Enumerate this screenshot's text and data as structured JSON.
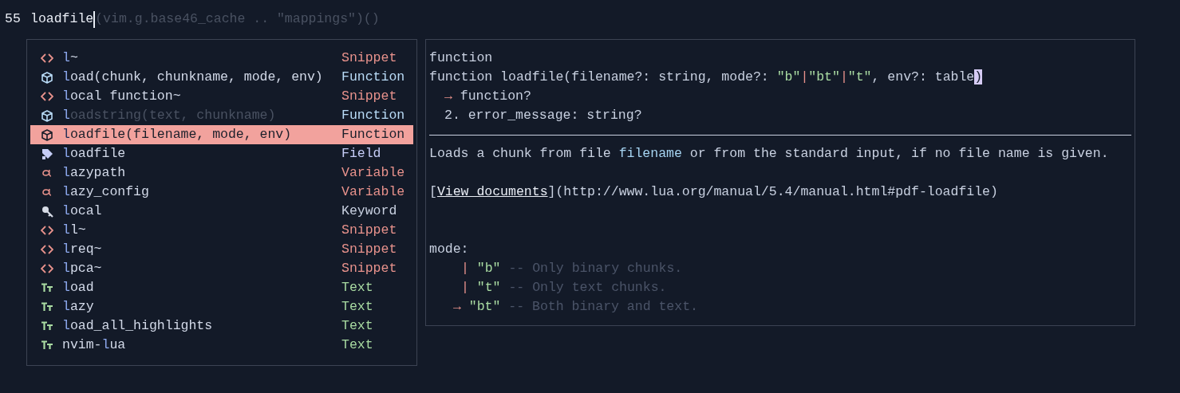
{
  "editor": {
    "lines": [
      {
        "number": "55",
        "typed": "loadfile",
        "ghost": "(vim.g.base46_cache .. \"mappings\")()",
        "cursor": true
      }
    ]
  },
  "completion": {
    "items": [
      {
        "kind": "snippet",
        "label": [
          {
            "text": "l",
            "matched": true
          },
          {
            "text": "~",
            "matched": false
          }
        ],
        "type_label": "Snippet",
        "selected": false,
        "dimmed": false
      },
      {
        "kind": "function",
        "label": [
          {
            "text": "l",
            "matched": true
          },
          {
            "text": "oad(chunk, chunkname, mode, env)",
            "matched": false
          }
        ],
        "type_label": "Function",
        "selected": false,
        "dimmed": false
      },
      {
        "kind": "snippet",
        "label": [
          {
            "text": "l",
            "matched": true
          },
          {
            "text": "ocal function~",
            "matched": false
          }
        ],
        "type_label": "Snippet",
        "selected": false,
        "dimmed": false
      },
      {
        "kind": "function",
        "label": [
          {
            "text": "l",
            "matched": true
          },
          {
            "text": "oadstring(text, chunkname)",
            "matched": false
          }
        ],
        "type_label": "Function",
        "selected": false,
        "dimmed": true
      },
      {
        "kind": "function",
        "label": [
          {
            "text": "l",
            "matched": true
          },
          {
            "text": "oadfile(filename, mode, env)",
            "matched": false
          }
        ],
        "type_label": "Function",
        "selected": true,
        "dimmed": false
      },
      {
        "kind": "field",
        "label": [
          {
            "text": "l",
            "matched": true
          },
          {
            "text": "oadfile",
            "matched": false
          }
        ],
        "type_label": "Field",
        "selected": false,
        "dimmed": false
      },
      {
        "kind": "variable",
        "label": [
          {
            "text": "l",
            "matched": true
          },
          {
            "text": "azypath",
            "matched": false
          }
        ],
        "type_label": "Variable",
        "selected": false,
        "dimmed": false
      },
      {
        "kind": "variable",
        "label": [
          {
            "text": "l",
            "matched": true
          },
          {
            "text": "azy_config",
            "matched": false
          }
        ],
        "type_label": "Variable",
        "selected": false,
        "dimmed": false
      },
      {
        "kind": "keyword",
        "label": [
          {
            "text": "l",
            "matched": true
          },
          {
            "text": "ocal",
            "matched": false
          }
        ],
        "type_label": "Keyword",
        "selected": false,
        "dimmed": false
      },
      {
        "kind": "snippet",
        "label": [
          {
            "text": "l",
            "matched": true
          },
          {
            "text": "l~",
            "matched": false
          }
        ],
        "type_label": "Snippet",
        "selected": false,
        "dimmed": false
      },
      {
        "kind": "snippet",
        "label": [
          {
            "text": "l",
            "matched": true
          },
          {
            "text": "req~",
            "matched": false
          }
        ],
        "type_label": "Snippet",
        "selected": false,
        "dimmed": false
      },
      {
        "kind": "snippet",
        "label": [
          {
            "text": "l",
            "matched": true
          },
          {
            "text": "pca~",
            "matched": false
          }
        ],
        "type_label": "Snippet",
        "selected": false,
        "dimmed": false
      },
      {
        "kind": "text",
        "label": [
          {
            "text": "l",
            "matched": true
          },
          {
            "text": "oad",
            "matched": false
          }
        ],
        "type_label": "Text",
        "selected": false,
        "dimmed": false
      },
      {
        "kind": "text",
        "label": [
          {
            "text": "l",
            "matched": true
          },
          {
            "text": "azy",
            "matched": false
          }
        ],
        "type_label": "Text",
        "selected": false,
        "dimmed": false
      },
      {
        "kind": "text",
        "label": [
          {
            "text": "l",
            "matched": true
          },
          {
            "text": "oad_all_highlights",
            "matched": false
          }
        ],
        "type_label": "Text",
        "selected": false,
        "dimmed": false
      },
      {
        "kind": "text",
        "label": [
          {
            "text": "nvim-",
            "matched": false
          },
          {
            "text": "l",
            "matched": true
          },
          {
            "text": "ua",
            "matched": false
          }
        ],
        "type_label": "Text",
        "selected": false,
        "dimmed": false
      }
    ]
  },
  "documentation": {
    "header": "function",
    "signature": [
      {
        "kind": "plain",
        "text": "function loadfile(filename?: string, mode?: ",
        "cursor": false
      },
      {
        "kind": "string",
        "text": "\"b\"",
        "cursor": false
      },
      {
        "kind": "pipe",
        "text": "|",
        "cursor": false
      },
      {
        "kind": "string",
        "text": "\"bt\"",
        "cursor": false
      },
      {
        "kind": "pipe",
        "text": "|",
        "cursor": false
      },
      {
        "kind": "string",
        "text": "\"t\"",
        "cursor": false
      },
      {
        "kind": "plain",
        "text": ", env?: table",
        "cursor": false
      },
      {
        "kind": "plain",
        "text": ")",
        "cursor": true
      }
    ],
    "returns": [
      {
        "marker": "→",
        "text": "function?",
        "kind": "arrow"
      },
      {
        "marker": "2.",
        "text": "error_message: string?",
        "kind": "number"
      }
    ],
    "description": [
      {
        "kind": "plain",
        "text": "Loads a chunk from file "
      },
      {
        "kind": "code",
        "text": "filename"
      },
      {
        "kind": "plain",
        "text": " or from the standard input, if no file name is given."
      }
    ],
    "link": {
      "open": "[",
      "text": "View documents",
      "close": "]",
      "url": "(http://www.lua.org/manual/5.4/manual.html#pdf-loadfile)"
    },
    "param": {
      "label": "mode:",
      "options": [
        {
          "marker": "|",
          "value": "\"b\"",
          "comment": "-- Only binary chunks.",
          "default": false
        },
        {
          "marker": "|",
          "value": "\"t\"",
          "comment": "-- Only text chunks.",
          "default": false
        },
        {
          "marker": "→",
          "value": "\"bt\"",
          "comment": "-- Both binary and text.",
          "default": true
        }
      ]
    }
  }
}
